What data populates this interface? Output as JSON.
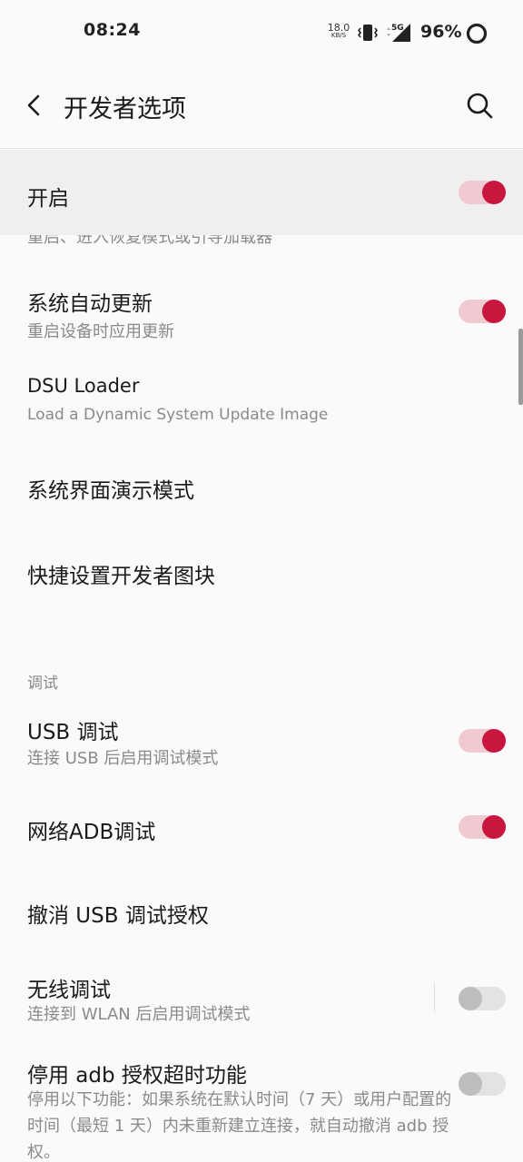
{
  "status_bar": {
    "time": "08:24",
    "net_speed_value": "18.0",
    "net_speed_unit": "KB/S",
    "network_type": "5G",
    "battery": "96%",
    "icons": [
      "vibrate-icon",
      "signal-icon",
      "battery-icon"
    ]
  },
  "header": {
    "title": "开发者选项",
    "back_icon": "back-arrow-icon",
    "search_icon": "search-icon"
  },
  "master_switch": {
    "label": "开启",
    "enabled": true
  },
  "cut_summary": "重启、进入恢复模式或引导加载器",
  "items": {
    "auto_update": {
      "title": "系统自动更新",
      "summary": "重启设备时应用更新",
      "enabled": true
    },
    "dsu_loader": {
      "title": "DSU Loader",
      "summary": "Load a Dynamic System Update Image"
    },
    "demo_mode": {
      "title": "系统界面演示模式"
    },
    "quick_tiles": {
      "title": "快捷设置开发者图块"
    }
  },
  "debug_section": {
    "header": "调试",
    "usb_debug": {
      "title": "USB 调试",
      "summary": "连接 USB 后启用调试模式",
      "enabled": true
    },
    "network_adb": {
      "title": "网络ADB调试",
      "enabled": true
    },
    "revoke_usb": {
      "title": "撤消 USB 调试授权"
    },
    "wireless_debug": {
      "title": "无线调试",
      "summary": "连接到 WLAN 后启用调试模式",
      "enabled": false
    },
    "adb_timeout": {
      "title": "停用 adb 授权超时功能",
      "summary": "停用以下功能：如果系统在默认时间（7 天）或用户配置的时间（最短 1 天）内未重新建立连接，就自动撤消 adb 授权。",
      "enabled": false
    }
  },
  "colors": {
    "accent": "#c8163f",
    "accent_track": "#f0c9d1",
    "background": "#fafafa",
    "secondary_text": "#8a8a8a"
  }
}
